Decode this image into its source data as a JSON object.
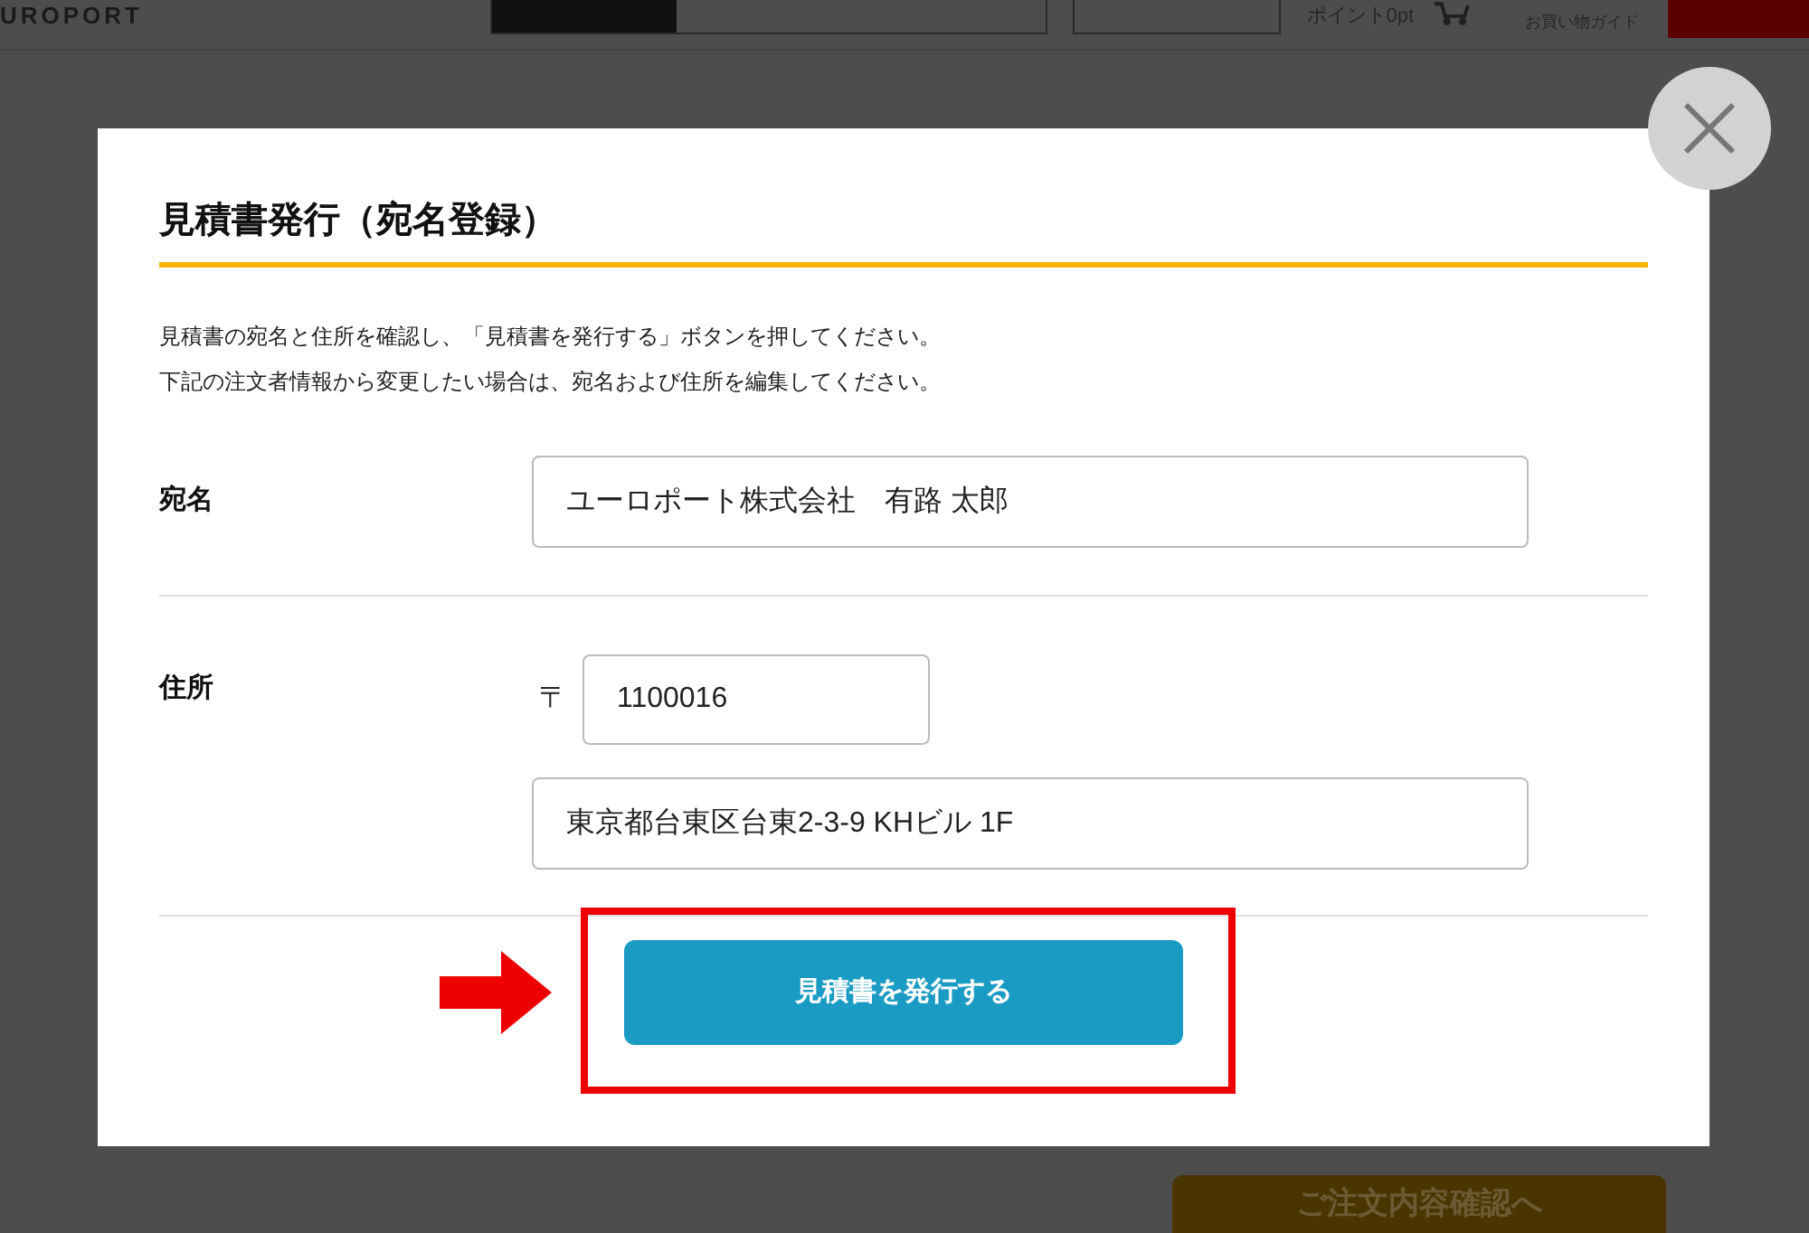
{
  "header": {
    "logo": "UROPORT",
    "points": "ポイント0pt",
    "guide": "お買い物ガイド"
  },
  "background": {
    "cta": "ご注文内容確認へ"
  },
  "modal": {
    "title": "見積書発行（宛名登録）",
    "description": [
      "見積書の宛名と住所を確認し、「見積書を発行する」ボタンを押してください。",
      "下記の注文者情報から変更したい場合は、宛名および住所を編集してください。"
    ],
    "recipient": {
      "label": "宛名",
      "value": "ユーロポート株式会社　有路 太郎"
    },
    "address": {
      "label": "住所",
      "postal_mark": "〒",
      "postal_code": "1100016",
      "street": "東京都台東区台東2-3-9 KHビル 1F"
    },
    "submit": "見積書を発行する"
  }
}
